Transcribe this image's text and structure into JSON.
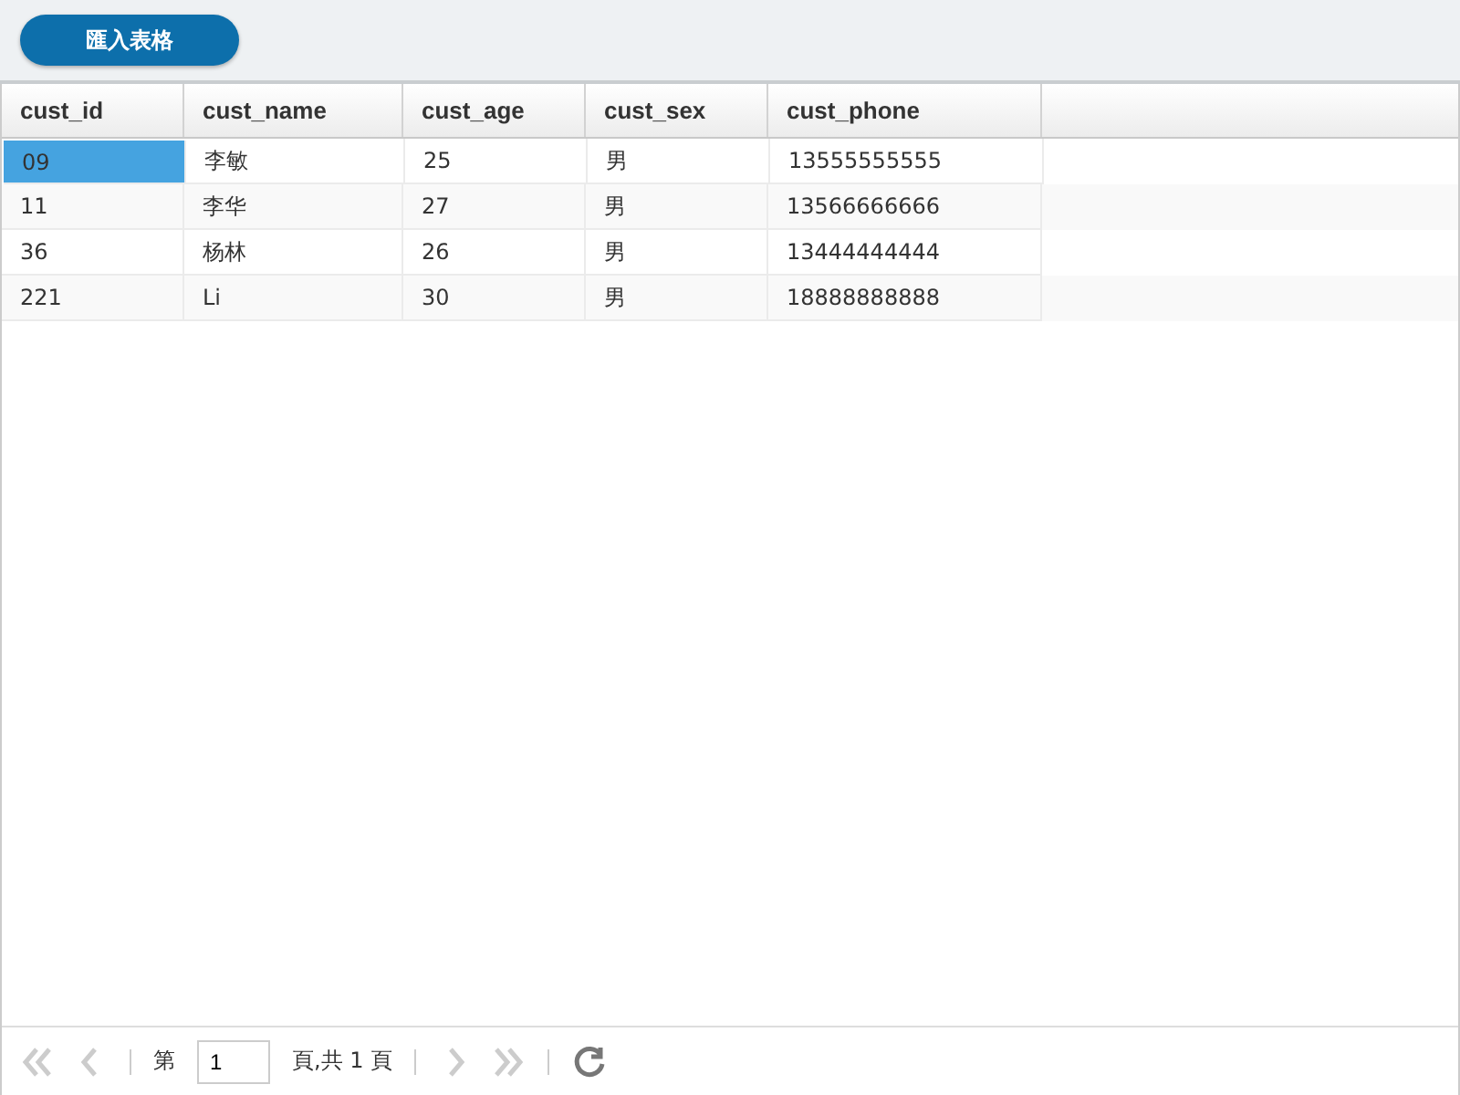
{
  "toolbar": {
    "button": "匯入表格"
  },
  "table": {
    "columns": [
      "cust_id",
      "cust_name",
      "cust_age",
      "cust_sex",
      "cust_phone"
    ],
    "rows": [
      {
        "cells": [
          {
            "text": "09",
            "selected": true
          },
          {
            "text": "李敏",
            "selected": false
          },
          {
            "text": "25",
            "selected": false
          },
          {
            "text": "男",
            "selected": false
          },
          {
            "text": "13555555555",
            "selected": false
          }
        ]
      },
      {
        "cells": [
          {
            "text": "11",
            "selected": false
          },
          {
            "text": "李华",
            "selected": false
          },
          {
            "text": "27",
            "selected": false
          },
          {
            "text": "男",
            "selected": false
          },
          {
            "text": "13566666666",
            "selected": false
          }
        ]
      },
      {
        "cells": [
          {
            "text": "36",
            "selected": false
          },
          {
            "text": "杨林",
            "selected": false
          },
          {
            "text": "26",
            "selected": false
          },
          {
            "text": "男",
            "selected": false
          },
          {
            "text": "13444444444",
            "selected": false
          }
        ]
      },
      {
        "cells": [
          {
            "text": "221",
            "selected": false
          },
          {
            "text": "Li",
            "selected": false
          },
          {
            "text": "30",
            "selected": false
          },
          {
            "text": "男",
            "selected": false
          },
          {
            "text": "18888888888",
            "selected": false
          }
        ]
      }
    ]
  },
  "pager": {
    "first_disabled": true,
    "prev_disabled": true,
    "next_disabled": true,
    "last_disabled": true,
    "before": "第",
    "page": "1",
    "after": "頁,共 1 頁"
  }
}
